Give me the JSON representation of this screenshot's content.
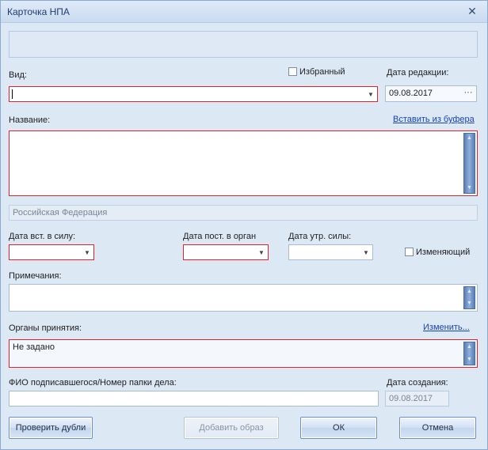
{
  "window": {
    "title": "Карточка НПА",
    "close_glyph": "✕"
  },
  "labels": {
    "vid": "Вид:",
    "izbrannyi": "Избранный",
    "data_redakcii": "Дата редакции:",
    "nazvanie": "Название:",
    "vstavit_iz_bufera": "Вставить из буфера",
    "data_vst_v_silu": "Дата вст. в силу:",
    "data_post_v_organ": "Дата пост. в орган",
    "data_utr_sily": "Дата утр. силы:",
    "izmenyayushchiy": "Изменяющий",
    "primechaniya": "Примечания:",
    "organy_prinyatiya": "Органы принятия:",
    "izmenit": "Изменить...",
    "fio": "ФИО подписавшегося/Номер папки дела:",
    "data_sozdaniya": "Дата создания:"
  },
  "fields": {
    "vid_value": "",
    "data_redakcii_value": "09.08.2017",
    "ellipsis": "···",
    "nazvanie_value": "",
    "region_value": "Российская Федерация",
    "data_vst_value": "",
    "data_post_value": "",
    "data_utr_value": "",
    "primechaniya_value": "",
    "organy_value": "Не задано",
    "fio_value": "",
    "data_sozdaniya_value": "09.08.2017"
  },
  "checkboxes": {
    "izbrannyi_checked": false,
    "izmenyayushchiy_checked": false
  },
  "buttons": {
    "proverit_dubli": "Проверить дубли",
    "dobavit_obraz": "Добавить образ",
    "ok": "ОК",
    "otmena": "Отмена"
  },
  "icons": {
    "dropdown": "chevron-down-icon",
    "scroll_up": "triangle-up-icon",
    "scroll_down": "triangle-down-icon"
  },
  "colors": {
    "required_border": "#d9242b",
    "link": "#1a44b8",
    "window_bg": "#dde8f5"
  }
}
